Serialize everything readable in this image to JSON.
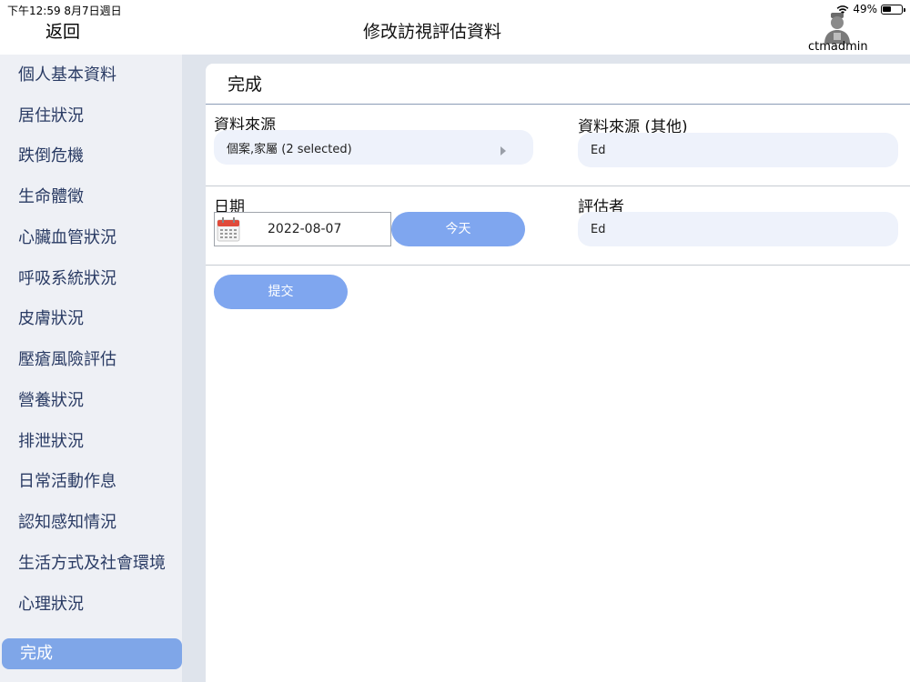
{
  "status_bar": {
    "time": "下午12:59   8月7日週日",
    "battery": "49%",
    "battery_level": 0.49
  },
  "nav": {
    "back_label": "返回",
    "title": "修改訪視評估資料",
    "username": "ctmadmin"
  },
  "sidebar": {
    "items": [
      {
        "label": "個人基本資料"
      },
      {
        "label": "居住狀況"
      },
      {
        "label": "跌倒危機"
      },
      {
        "label": "生命體徵"
      },
      {
        "label": "心臟血管狀況"
      },
      {
        "label": "呼吸系統狀況"
      },
      {
        "label": "皮膚狀況"
      },
      {
        "label": "壓瘡風險評估"
      },
      {
        "label": "營養狀況"
      },
      {
        "label": "排泄狀況"
      },
      {
        "label": "日常活動作息"
      },
      {
        "label": "認知感知情況"
      },
      {
        "label": "生活方式及社會環境"
      },
      {
        "label": "心理狀況"
      },
      {
        "label": "完成"
      }
    ],
    "active_index": 14
  },
  "form": {
    "section_title": "完成",
    "source_label": "資料來源",
    "source_value": "個案,家屬 (2 selected)",
    "source_other_label": "資料來源 (其他)",
    "source_other_value": "Ed",
    "date_label": "日期",
    "date_value": "2022-08-07",
    "today_label": "今天",
    "assessor_label": "評估者",
    "assessor_value": "Ed",
    "submit_label": "提交"
  },
  "colors": {
    "accent": "#7fa6ef",
    "sidebar_bg": "#eef0f5",
    "sidebar_text": "#2a3b64"
  }
}
